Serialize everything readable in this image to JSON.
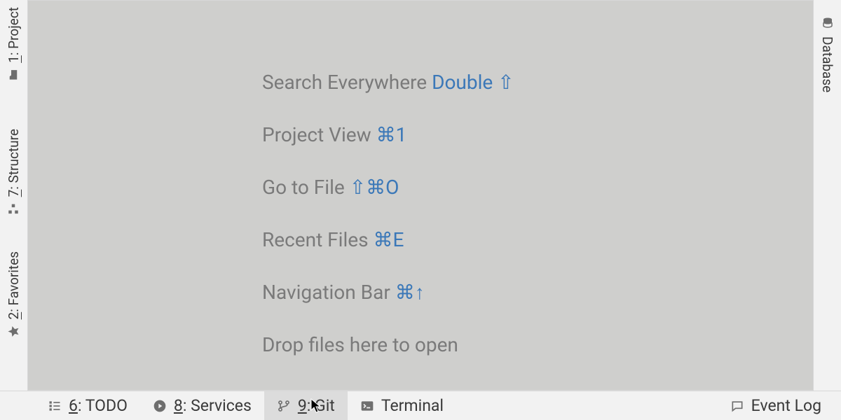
{
  "left": {
    "project": {
      "mnemonic": "1",
      "label": ": Project"
    },
    "structure": {
      "mnemonic": "7",
      "label": ": Structure"
    },
    "favorites": {
      "mnemonic": "2",
      "label": ": Favorites"
    }
  },
  "right": {
    "database": {
      "label": "Database"
    }
  },
  "hints": {
    "search": {
      "label": "Search Everywhere ",
      "shortcut": "Double ⇧"
    },
    "project_view": {
      "label": "Project View ",
      "shortcut": "⌘1"
    },
    "goto_file": {
      "label": "Go to File ",
      "shortcut": "⇧⌘O"
    },
    "recent": {
      "label": "Recent Files ",
      "shortcut": "⌘E"
    },
    "navbar": {
      "label": "Navigation Bar ",
      "shortcut": "⌘↑"
    },
    "drop": {
      "label": "Drop files here to open"
    }
  },
  "bottom": {
    "todo": {
      "mnemonic": "6",
      "label": ": TODO"
    },
    "services": {
      "mnemonic": "8",
      "label": ": Services"
    },
    "git": {
      "mnemonic": "9",
      "label": ": Git"
    },
    "terminal": {
      "label": "Terminal"
    },
    "event_log": {
      "label": "Event Log"
    }
  }
}
